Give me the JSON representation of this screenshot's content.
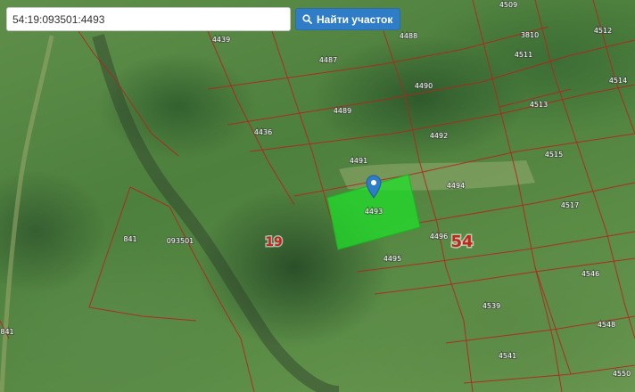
{
  "search": {
    "value": "54:19:093501:4493",
    "button_label": "Найти участок",
    "icon": "search-icon"
  },
  "map": {
    "type": "satellite",
    "parcel_color": "#b3261e",
    "highlight_color": "#1fe02a",
    "marker_color": "#2f7cc7",
    "highlighted_parcel_label": "4493",
    "big_labels": {
      "region": "54",
      "district": "19"
    },
    "quarter_label": "093501",
    "parcel_labels": [
      "4439",
      "4488",
      "4487",
      "4509",
      "3810",
      "4512",
      "4511",
      "4514",
      "4490",
      "4489",
      "4513",
      "4436",
      "4492",
      "4515",
      "4491",
      "4494",
      "4517",
      "4496",
      "4495",
      "841",
      "4546",
      "4539",
      "4548",
      "4541",
      "4550",
      "841"
    ]
  }
}
